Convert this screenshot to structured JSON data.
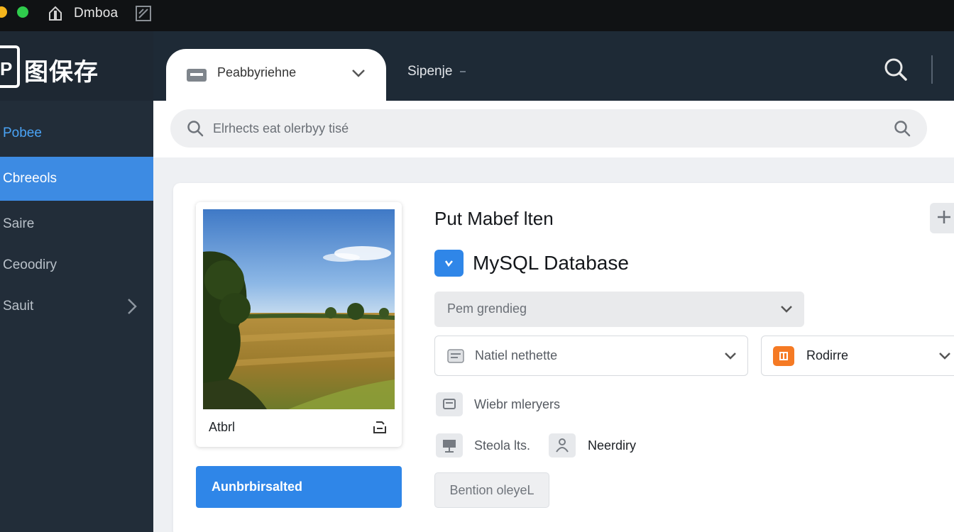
{
  "titlebar": {
    "app_name": "Dmboa"
  },
  "sidebar": {
    "brand": "图保存",
    "items": [
      {
        "label": "Pobee"
      },
      {
        "label": "Cbreeols"
      },
      {
        "label": "Saire"
      },
      {
        "label": "Ceoodiry"
      },
      {
        "label": "Sauit"
      }
    ],
    "active_index": 1
  },
  "header": {
    "tab_active": "Peabbyriehne",
    "tab_second": "Sipenje"
  },
  "search": {
    "placeholder": "Elrhects eat olerbyy tisé"
  },
  "photo_card": {
    "caption": "Atbrl",
    "primary_button": "Aunbrbirsalted"
  },
  "details": {
    "title": "Put Mabef lten",
    "database": "MySQL Database",
    "select_wide": "Pem grendieg",
    "select_left": "Natiel nethette",
    "select_right": "Rodirre",
    "row1": "Wiebr mleryers",
    "row2_left": "Steola lts.",
    "row2_right": "Neerdiry",
    "secondary_button": "Bention oleyeL"
  },
  "colors": {
    "accent": "#2f86e8",
    "sidebar_bg": "#222d39",
    "orange_badge": "#f57a24"
  }
}
